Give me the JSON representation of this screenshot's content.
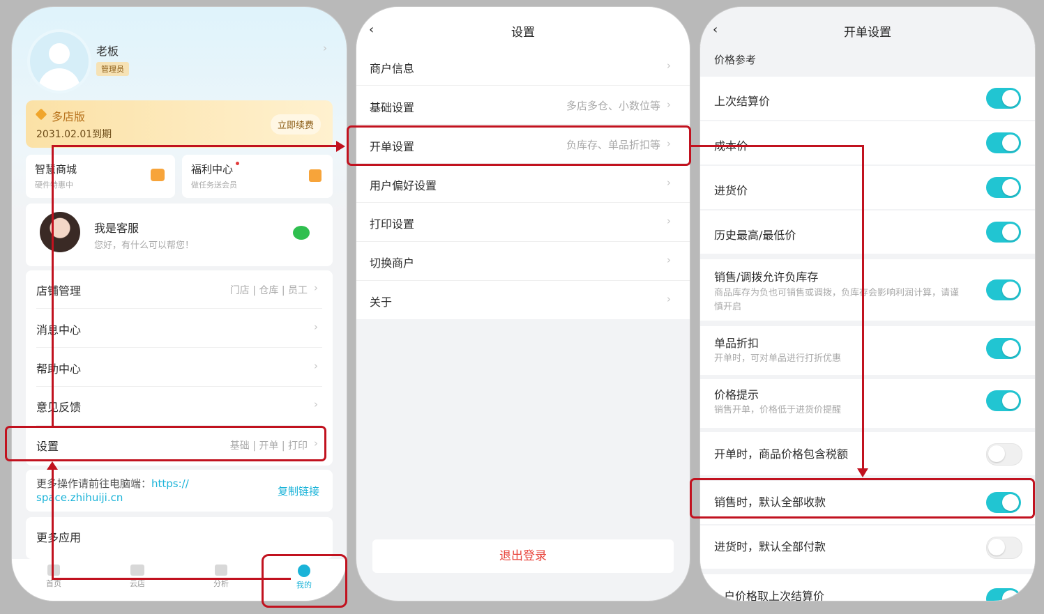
{
  "colors": {
    "accent": "#21c5d2",
    "highlight": "#c1121f",
    "logout": "#e8453c",
    "gold": "#b8731d"
  },
  "profile": {
    "name": "老板",
    "role": "管理员"
  },
  "plan": {
    "name": "多店版",
    "expiry": "2031.02.01到期",
    "renew_label": "立即续费"
  },
  "shortcuts": [
    {
      "title": "智慧商城",
      "subtitle": "硬件特惠中",
      "icon": "shopping-bag-icon"
    },
    {
      "title": "福利中心",
      "subtitle": "做任务送会员",
      "icon": "gift-icon"
    }
  ],
  "service": {
    "title": "我是客服",
    "subtitle": "您好，有什么可以帮您！",
    "icon": "wechat-icon"
  },
  "menu": [
    {
      "label": "店铺管理",
      "detail": "门店 | 仓库 | 员工"
    },
    {
      "label": "消息中心",
      "detail": ""
    },
    {
      "label": "帮助中心",
      "detail": ""
    },
    {
      "label": "意见反馈",
      "detail": ""
    },
    {
      "label": "设置",
      "detail": "基础 | 开单 | 打印"
    }
  ],
  "desktop": {
    "text": "更多操作请前往电脑端：",
    "url": "https://space.zhihuiji.cn",
    "url_a": "https://",
    "url_b": "space.zhihuiji.cn",
    "copy_label": "复制链接"
  },
  "more_apps": "更多应用",
  "tabbar": [
    {
      "label": "首页",
      "icon": "home-icon"
    },
    {
      "label": "云店",
      "icon": "store-icon"
    },
    {
      "label": "分析",
      "icon": "chart-icon"
    },
    {
      "label": "我的",
      "icon": "user-icon"
    }
  ],
  "settings": {
    "back": "‹",
    "title": "设置",
    "items": [
      {
        "label": "商户信息",
        "detail": ""
      },
      {
        "label": "基础设置",
        "detail": "多店多仓、小数位等"
      },
      {
        "label": "开单设置",
        "detail": "负库存、单品折扣等"
      },
      {
        "label": "用户偏好设置",
        "detail": ""
      },
      {
        "label": "打印设置",
        "detail": ""
      },
      {
        "label": "切换商户",
        "detail": ""
      },
      {
        "label": "关于",
        "detail": ""
      }
    ],
    "logout": "退出登录"
  },
  "order_settings": {
    "back": "‹",
    "title": "开单设置",
    "section": "价格参考",
    "items": [
      {
        "label": "上次结算价",
        "desc": "",
        "on": true
      },
      {
        "label": "成本价",
        "desc": "",
        "on": true
      },
      {
        "label": "进货价",
        "desc": "",
        "on": true
      },
      {
        "label": "历史最高/最低价",
        "desc": "",
        "on": true
      },
      {
        "label": "销售/调拨允许负库存",
        "desc_1": "商品库存为负也可销售或调拨，负库存会影响利润计算，请谨",
        "desc_2": "慎开启",
        "on": true
      },
      {
        "label": "单品折扣",
        "desc": "开单时，可对单品进行打折优惠",
        "on": true
      },
      {
        "label": "价格提示",
        "desc": "销售开单，价格低于进货价提醒",
        "on": true
      },
      {
        "label": "开单时，商品价格包含税额",
        "desc": "",
        "on": false
      },
      {
        "label": "销售时，默认全部收款",
        "desc": "",
        "on": true
      },
      {
        "label": "进货时，默认全部付款",
        "desc": "",
        "on": false
      },
      {
        "label": "户价格取上次结算价",
        "desc": "",
        "on": true
      }
    ]
  }
}
